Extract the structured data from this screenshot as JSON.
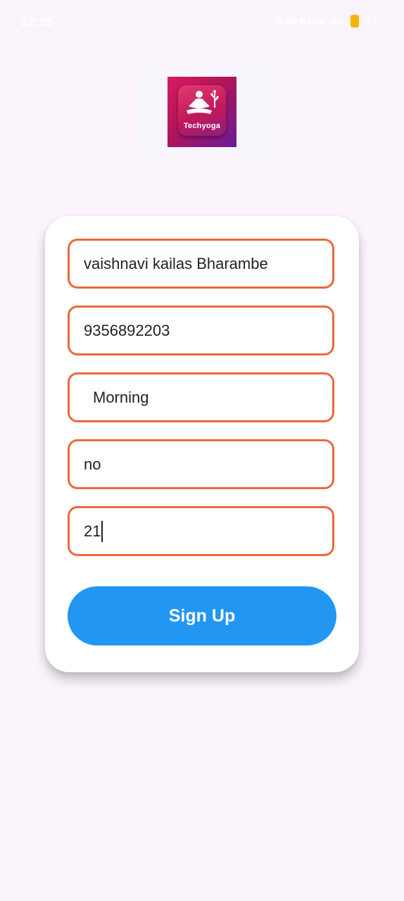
{
  "status_bar": {
    "time": "22:55",
    "network": "0.00 KB/s",
    "signal": "4G",
    "battery": "37"
  },
  "logo": {
    "text": "Techyoga"
  },
  "form": {
    "fields": [
      {
        "value": "vaishnavi kailas Bharambe"
      },
      {
        "value": "9356892203"
      },
      {
        "value": "Morning"
      },
      {
        "value": "no"
      },
      {
        "value": "21"
      }
    ],
    "submit_label": "Sign Up"
  },
  "colors": {
    "background": "#fcf4fc",
    "field_border": "#ea6a3c",
    "button": "#2196f3"
  }
}
